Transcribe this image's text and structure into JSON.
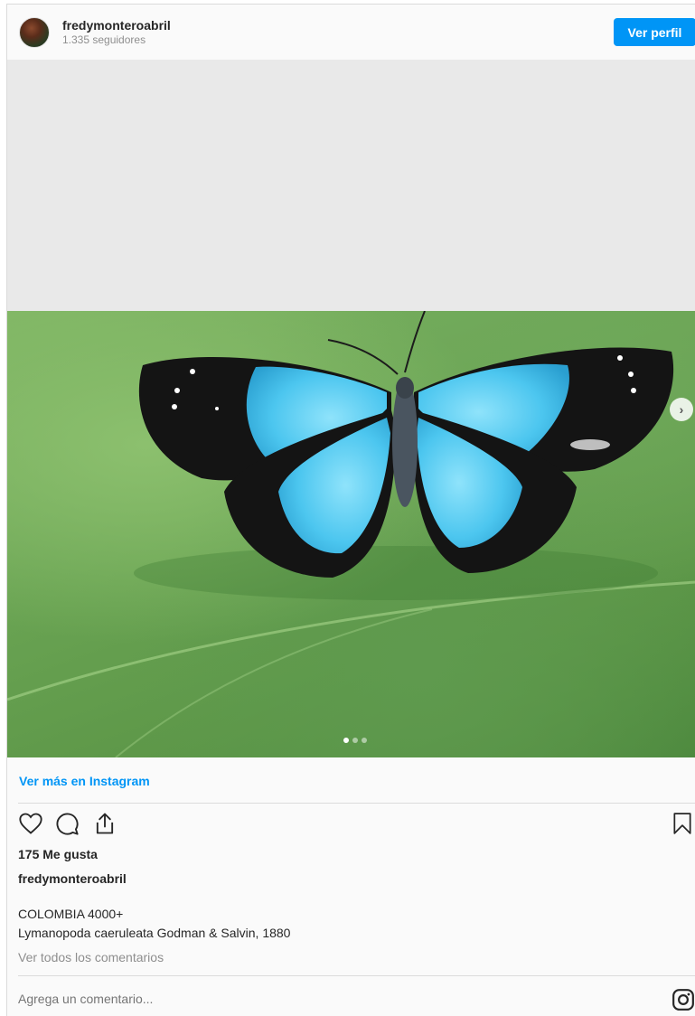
{
  "header": {
    "username": "fredymonteroabril",
    "followers": "1.335 seguidores",
    "profile_button": "Ver perfil"
  },
  "media": {
    "icons": {
      "next": "chevron-right-icon"
    },
    "carousel_total": 3,
    "carousel_current": 1
  },
  "footer": {
    "more_link": "Ver más en Instagram",
    "likes": "175 Me gusta",
    "caption_user": "fredymonteroabril",
    "caption_lines": [
      "COLOMBIA 4000+",
      "Lymanopoda caeruleata Godman & Salvin, 1880"
    ],
    "view_comments": "Ver todos los comentarios",
    "comment_placeholder": "Agrega un comentario...",
    "icons": [
      "heart-icon",
      "comment-icon",
      "share-icon",
      "bookmark-icon",
      "instagram-logo-icon"
    ]
  },
  "colors": {
    "accent": "#0095f6",
    "text": "#262626",
    "muted": "#8e8e8e",
    "wing_blue": "#4cc6ef"
  }
}
